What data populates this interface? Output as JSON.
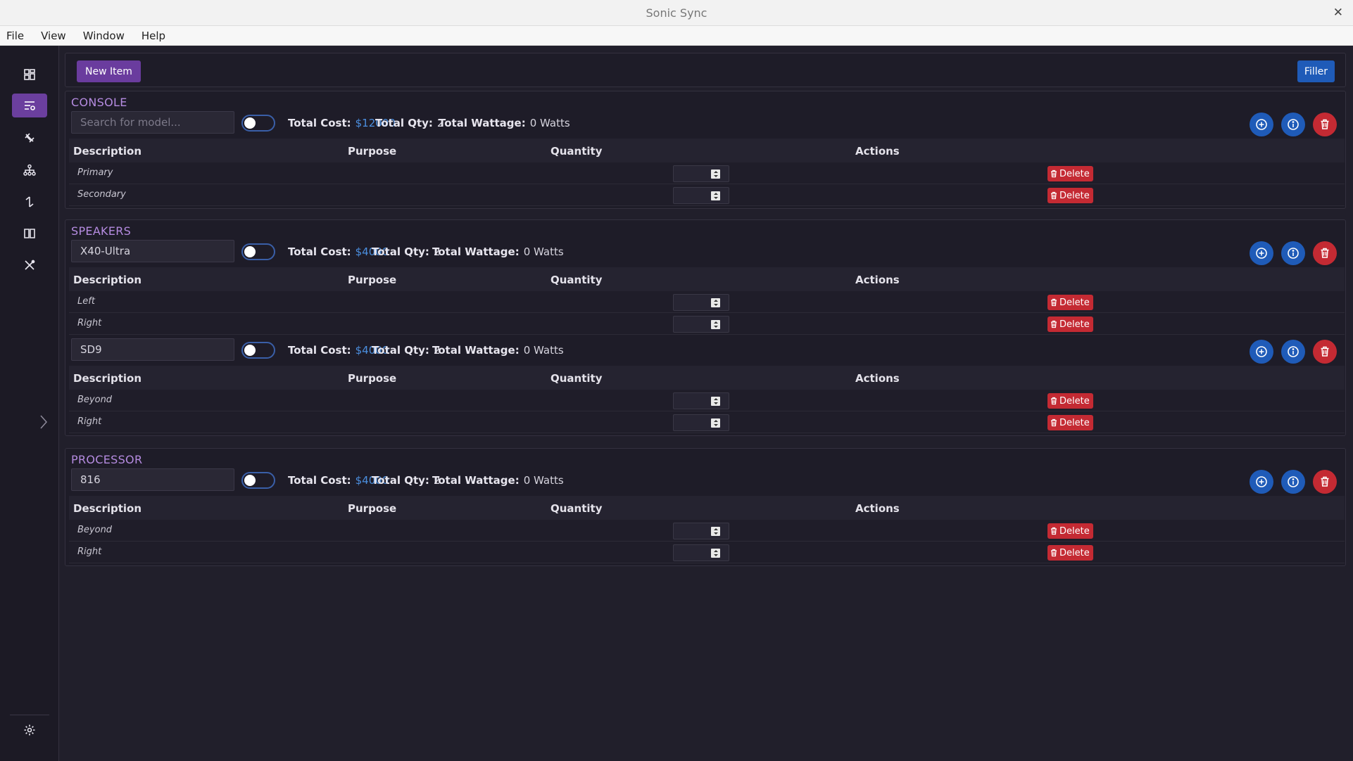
{
  "window": {
    "title": "Sonic Sync"
  },
  "menu": [
    "File",
    "View",
    "Window",
    "Help"
  ],
  "nav": {
    "items": [
      {
        "icon": "dashboard-icon",
        "active": false
      },
      {
        "icon": "inventory-list-icon",
        "active": true
      },
      {
        "icon": "cables-icon",
        "active": false
      },
      {
        "icon": "network-tree-icon",
        "active": false
      },
      {
        "icon": "signal-flow-icon",
        "active": false
      },
      {
        "icon": "book-icon",
        "active": false
      },
      {
        "icon": "tools-icon",
        "active": false
      }
    ],
    "bottom_icon": "settings-icon"
  },
  "toolbar": {
    "new_item": "New Item",
    "filler": "Filler"
  },
  "labels": {
    "total_cost": "Total Cost:",
    "total_qty": "Total Qty:",
    "total_wattage": "Total Wattage:",
    "delete": "Delete"
  },
  "table_headers": [
    "Description",
    "Purpose",
    "Quantity",
    "Actions"
  ],
  "sections": [
    {
      "title": "CONSOLE",
      "groups": [
        {
          "model_value": "",
          "model_placeholder": "Search for model...",
          "toggle_on": false,
          "total_cost": "$12000",
          "total_qty": "2",
          "total_wattage": "0 Watts",
          "rows": [
            {
              "description": "Primary",
              "purpose": "",
              "quantity": ""
            },
            {
              "description": "Secondary",
              "purpose": "",
              "quantity": ""
            }
          ]
        }
      ]
    },
    {
      "title": "SPEAKERS",
      "groups": [
        {
          "model_value": "X40-Ultra",
          "model_placeholder": "Search for model...",
          "toggle_on": false,
          "total_cost": "$4000",
          "total_qty": "2",
          "total_wattage": "0 Watts",
          "rows": [
            {
              "description": "Left",
              "purpose": "",
              "quantity": ""
            },
            {
              "description": "Right",
              "purpose": "",
              "quantity": ""
            }
          ]
        },
        {
          "model_value": "SD9",
          "model_placeholder": "Search for model...",
          "toggle_on": false,
          "total_cost": "$4000",
          "total_qty": "2",
          "total_wattage": "0 Watts",
          "rows": [
            {
              "description": "Beyond",
              "purpose": "",
              "quantity": ""
            },
            {
              "description": "Right",
              "purpose": "",
              "quantity": ""
            }
          ]
        }
      ]
    },
    {
      "title": "PROCESSOR",
      "groups": [
        {
          "model_value": "816",
          "model_placeholder": "Search for model...",
          "toggle_on": false,
          "total_cost": "$4000",
          "total_qty": "2",
          "total_wattage": "0 Watts",
          "rows": [
            {
              "description": "Beyond",
              "purpose": "",
              "quantity": ""
            },
            {
              "description": "Right",
              "purpose": "",
              "quantity": ""
            }
          ]
        }
      ]
    }
  ]
}
